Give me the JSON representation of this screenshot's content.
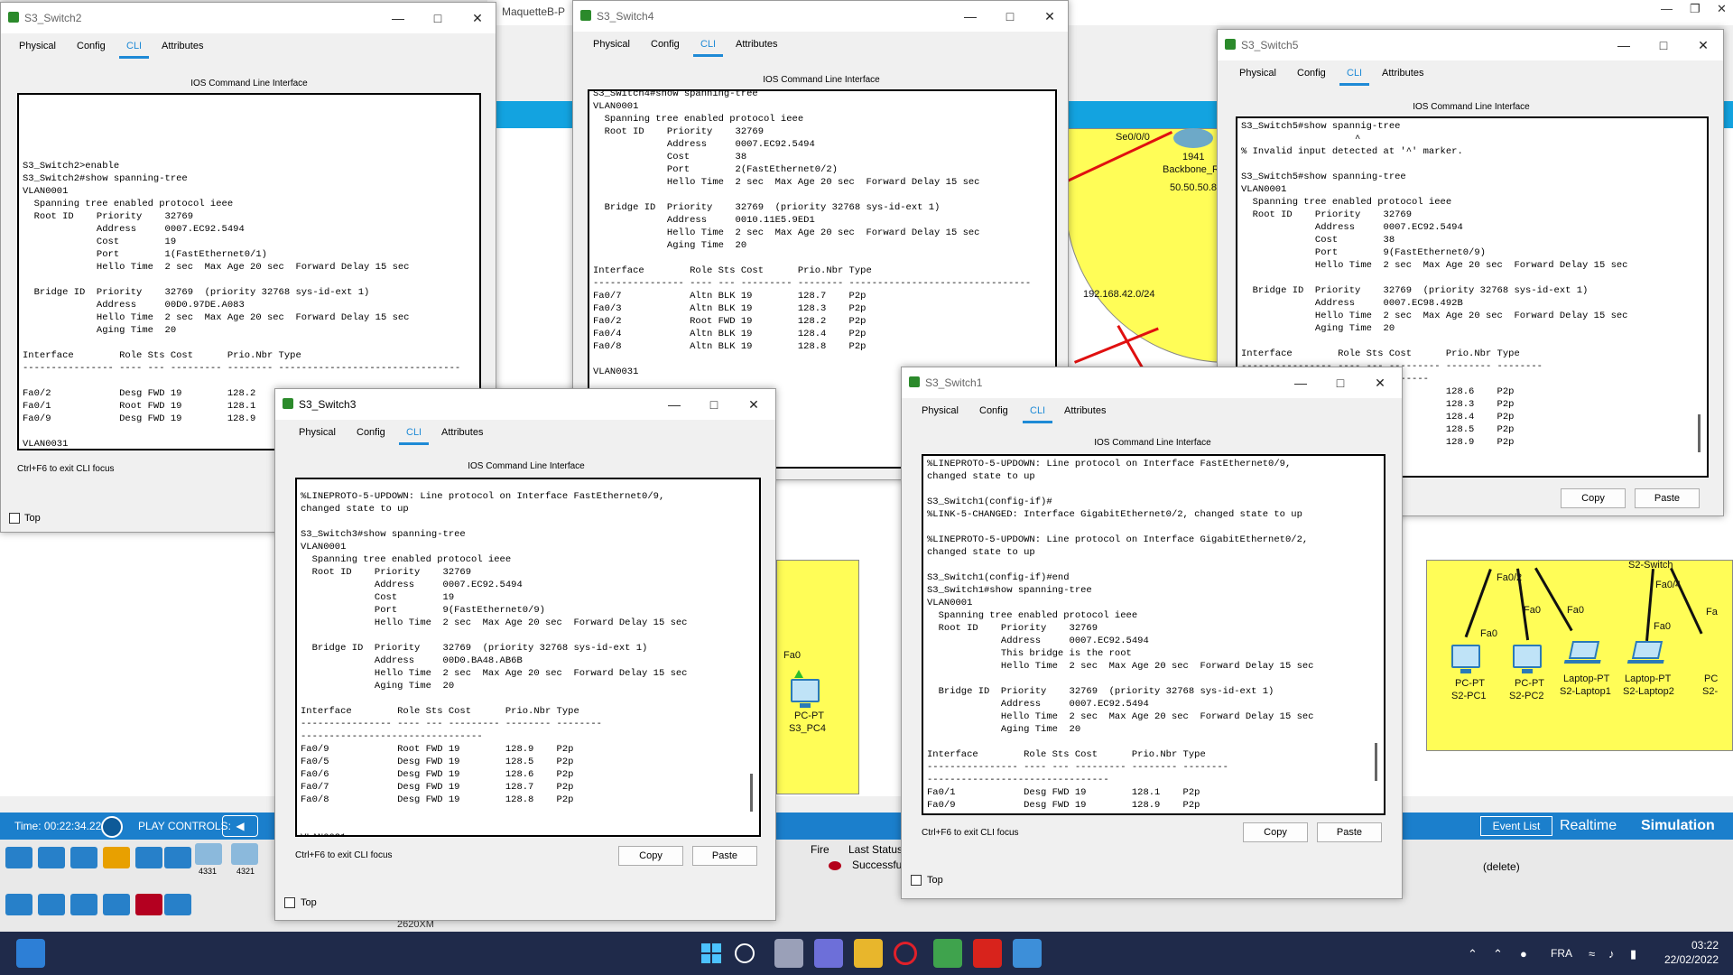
{
  "background_app": {
    "title": "MaquetteB-P",
    "status": {
      "time": "Time: 00:22:34.228",
      "play_controls": "PLAY CONTROLS:",
      "event_list": "Event List",
      "realtime": "Realtime",
      "simulation": "Simulation"
    },
    "network_labels": {
      "se": "Se0/0/0",
      "router_name": "1941",
      "router_sub": "Backbone_R",
      "ip": "50.50.50.8",
      "subnet": "192.168.42.0/24",
      "fa0_a": "Fa0",
      "pc4_a": "PC-PT",
      "pc4_b": "S3_PC4",
      "fa02": "Fa0/2",
      "fa04": "Fa0/4",
      "fa0_b": "Fa0",
      "fa0_c": "Fa0",
      "fa0_d": "Fa0",
      "fa0_e": "Fa0",
      "fa0_f": "Fa",
      "s2switch": "S2-Switch",
      "pc1_a": "PC-PT",
      "pc1_b": "S2-PC1",
      "pc2_a": "PC-PT",
      "pc2_b": "S2-PC2",
      "lap1_a": "Laptop-PT",
      "lap1_b": "S2-Laptop1",
      "lap2_a": "Laptop-PT",
      "lap2_b": "S2-Laptop2",
      "pc_c": "PC",
      "pc_c2": "S2-"
    },
    "device_panel": {
      "routers": [
        "4331",
        "4321"
      ],
      "caption": "2620XM",
      "pdu_headers": [
        "Fire",
        "Last Status"
      ],
      "pdu_status": "Successfu",
      "pdu_delete": "(delete)"
    }
  },
  "taskbar": {
    "lang": "FRA",
    "time": "03:22",
    "date": "22/02/2022"
  },
  "windows": {
    "switch2": {
      "title": "S3_Switch2",
      "tabs": [
        "Physical",
        "Config",
        "CLI",
        "Attributes"
      ],
      "header": "IOS Command Line Interface",
      "terminal": "\n\n\n\n\nS3_Switch2>enable\nS3_Switch2#show spanning-tree\nVLAN0001\n  Spanning tree enabled protocol ieee\n  Root ID    Priority    32769\n             Address     0007.EC92.5494\n             Cost        19\n             Port        1(FastEthernet0/1)\n             Hello Time  2 sec  Max Age 20 sec  Forward Delay 15 sec\n\n  Bridge ID  Priority    32769  (priority 32768 sys-id-ext 1)\n             Address     00D0.97DE.A083\n             Hello Time  2 sec  Max Age 20 sec  Forward Delay 15 sec\n             Aging Time  20\n\nInterface        Role Sts Cost      Prio.Nbr Type\n---------------- ---- --- --------- -------- --------------------------------\n\nFa0/2            Desg FWD 19        128.2    P2p\nFa0/1            Root FWD 19        128.1    P2p\nFa0/9            Desg FWD 19        128.9    P2p\n\nVLAN0031",
      "footer": "Ctrl+F6 to exit CLI focus",
      "top_label": "Top"
    },
    "switch4": {
      "title": "S3_Switch4",
      "tabs": [
        "Physical",
        "Config",
        "CLI",
        "Attributes"
      ],
      "header": "IOS Command Line Interface",
      "terminal": "S3_Switch4#show spanning-tree\nVLAN0001\n  Spanning tree enabled protocol ieee\n  Root ID    Priority    32769\n             Address     0007.EC92.5494\n             Cost        38\n             Port        2(FastEthernet0/2)\n             Hello Time  2 sec  Max Age 20 sec  Forward Delay 15 sec\n\n  Bridge ID  Priority    32769  (priority 32768 sys-id-ext 1)\n             Address     0010.11E5.9ED1\n             Hello Time  2 sec  Max Age 20 sec  Forward Delay 15 sec\n             Aging Time  20\n\nInterface        Role Sts Cost      Prio.Nbr Type\n---------------- ---- --- --------- -------- --------------------------------\nFa0/7            Altn BLK 19        128.7    P2p\nFa0/3            Altn BLK 19        128.3    P2p\nFa0/2            Root FWD 19        128.2    P2p\nFa0/4            Altn BLK 19        128.4    P2p\nFa0/8            Altn BLK 19        128.8    P2p\n\nVLAN0031\n                                                           col ieee\n                                                           .EC92.5494\n\n                                                           stEthernet0/2)\n                                                            Max Age 20 sec  Forward Delay 15 sec",
      "footer": "",
      "top_label": "Top"
    },
    "switch5": {
      "title": "S3_Switch5",
      "tabs": [
        "Physical",
        "Config",
        "CLI",
        "Attributes"
      ],
      "header": "IOS Command Line Interface",
      "terminal": "S3_Switch5#show spannig-tree\n                    ^\n% Invalid input detected at '^' marker.\n\nS3_Switch5#show spanning-tree\nVLAN0001\n  Spanning tree enabled protocol ieee\n  Root ID    Priority    32769\n             Address     0007.EC92.5494\n             Cost        38\n             Port        9(FastEthernet0/9)\n             Hello Time  2 sec  Max Age 20 sec  Forward Delay 15 sec\n\n  Bridge ID  Priority    32769  (priority 32768 sys-id-ext 1)\n             Address     0007.EC98.492B\n             Hello Time  2 sec  Max Age 20 sec  Forward Delay 15 sec\n             Aging Time  20\n\nInterface        Role Sts Cost      Prio.Nbr Type\n---------------- ---- --- --------- -------- --------\n---------------------------------\nFa0/6            Desg FWD 19        128.6    P2p\nFa0/3            Desg FWD 19        128.3    P2p\nFa0/4            Desg FWD 19        128.4    P2p\nFa0/5            Desg FWD 19        128.5    P2p\nFa0/9            Root FWD 19        128.9    P2p",
      "copy": "Copy",
      "paste": "Paste"
    },
    "switch3": {
      "title": "S3_Switch3",
      "tabs": [
        "Physical",
        "Config",
        "CLI",
        "Attributes"
      ],
      "header": "IOS Command Line Interface",
      "terminal": "%LINEPROTO-5-UPDOWN: Line protocol on Interface FastEthernet0/9,\nchanged state to up\n\nS3_Switch3#show spanning-tree\nVLAN0001\n  Spanning tree enabled protocol ieee\n  Root ID    Priority    32769\n             Address     0007.EC92.5494\n             Cost        19\n             Port        9(FastEthernet0/9)\n             Hello Time  2 sec  Max Age 20 sec  Forward Delay 15 sec\n\n  Bridge ID  Priority    32769  (priority 32768 sys-id-ext 1)\n             Address     00D0.BA48.AB6B\n             Hello Time  2 sec  Max Age 20 sec  Forward Delay 15 sec\n             Aging Time  20\n\nInterface        Role Sts Cost      Prio.Nbr Type\n---------------- ---- --- --------- -------- --------\n--------------------------------\nFa0/9            Root FWD 19        128.9    P2p\nFa0/5            Desg FWD 19        128.5    P2p\nFa0/6            Desg FWD 19        128.6    P2p\nFa0/7            Desg FWD 19        128.7    P2p\nFa0/8            Desg FWD 19        128.8    P2p\n\n\nVLAN0031",
      "footer": "Ctrl+F6 to exit CLI focus",
      "copy": "Copy",
      "paste": "Paste",
      "top_label": "Top"
    },
    "switch1": {
      "title": "S3_Switch1",
      "tabs": [
        "Physical",
        "Config",
        "CLI",
        "Attributes"
      ],
      "header": "IOS Command Line Interface",
      "terminal": "%LINEPROTO-5-UPDOWN: Line protocol on Interface FastEthernet0/9,\nchanged state to up\n\nS3_Switch1(config-if)#\n%LINK-5-CHANGED: Interface GigabitEthernet0/2, changed state to up\n\n%LINEPROTO-5-UPDOWN: Line protocol on Interface GigabitEthernet0/2,\nchanged state to up\n\nS3_Switch1(config-if)#end\nS3_Switch1#show spanning-tree\nVLAN0001\n  Spanning tree enabled protocol ieee\n  Root ID    Priority    32769\n             Address     0007.EC92.5494\n             This bridge is the root\n             Hello Time  2 sec  Max Age 20 sec  Forward Delay 15 sec\n\n  Bridge ID  Priority    32769  (priority 32768 sys-id-ext 1)\n             Address     0007.EC92.5494\n             Hello Time  2 sec  Max Age 20 sec  Forward Delay 15 sec\n             Aging Time  20\n\nInterface        Role Sts Cost      Prio.Nbr Type\n---------------- ---- --- --------- -------- --------\n--------------------------------\nFa0/1            Desg FWD 19        128.1    P2p\nFa0/9            Desg FWD 19        128.9    P2p",
      "footer": "Ctrl+F6 to exit CLI focus",
      "copy": "Copy",
      "paste": "Paste",
      "top_label": "Top"
    }
  },
  "colors": {
    "accent": "#1e8ad6",
    "status_bar": "#1b7fcc",
    "taskbar": "#1f2a4a",
    "area": "#fffd57",
    "link": "#e01010"
  }
}
